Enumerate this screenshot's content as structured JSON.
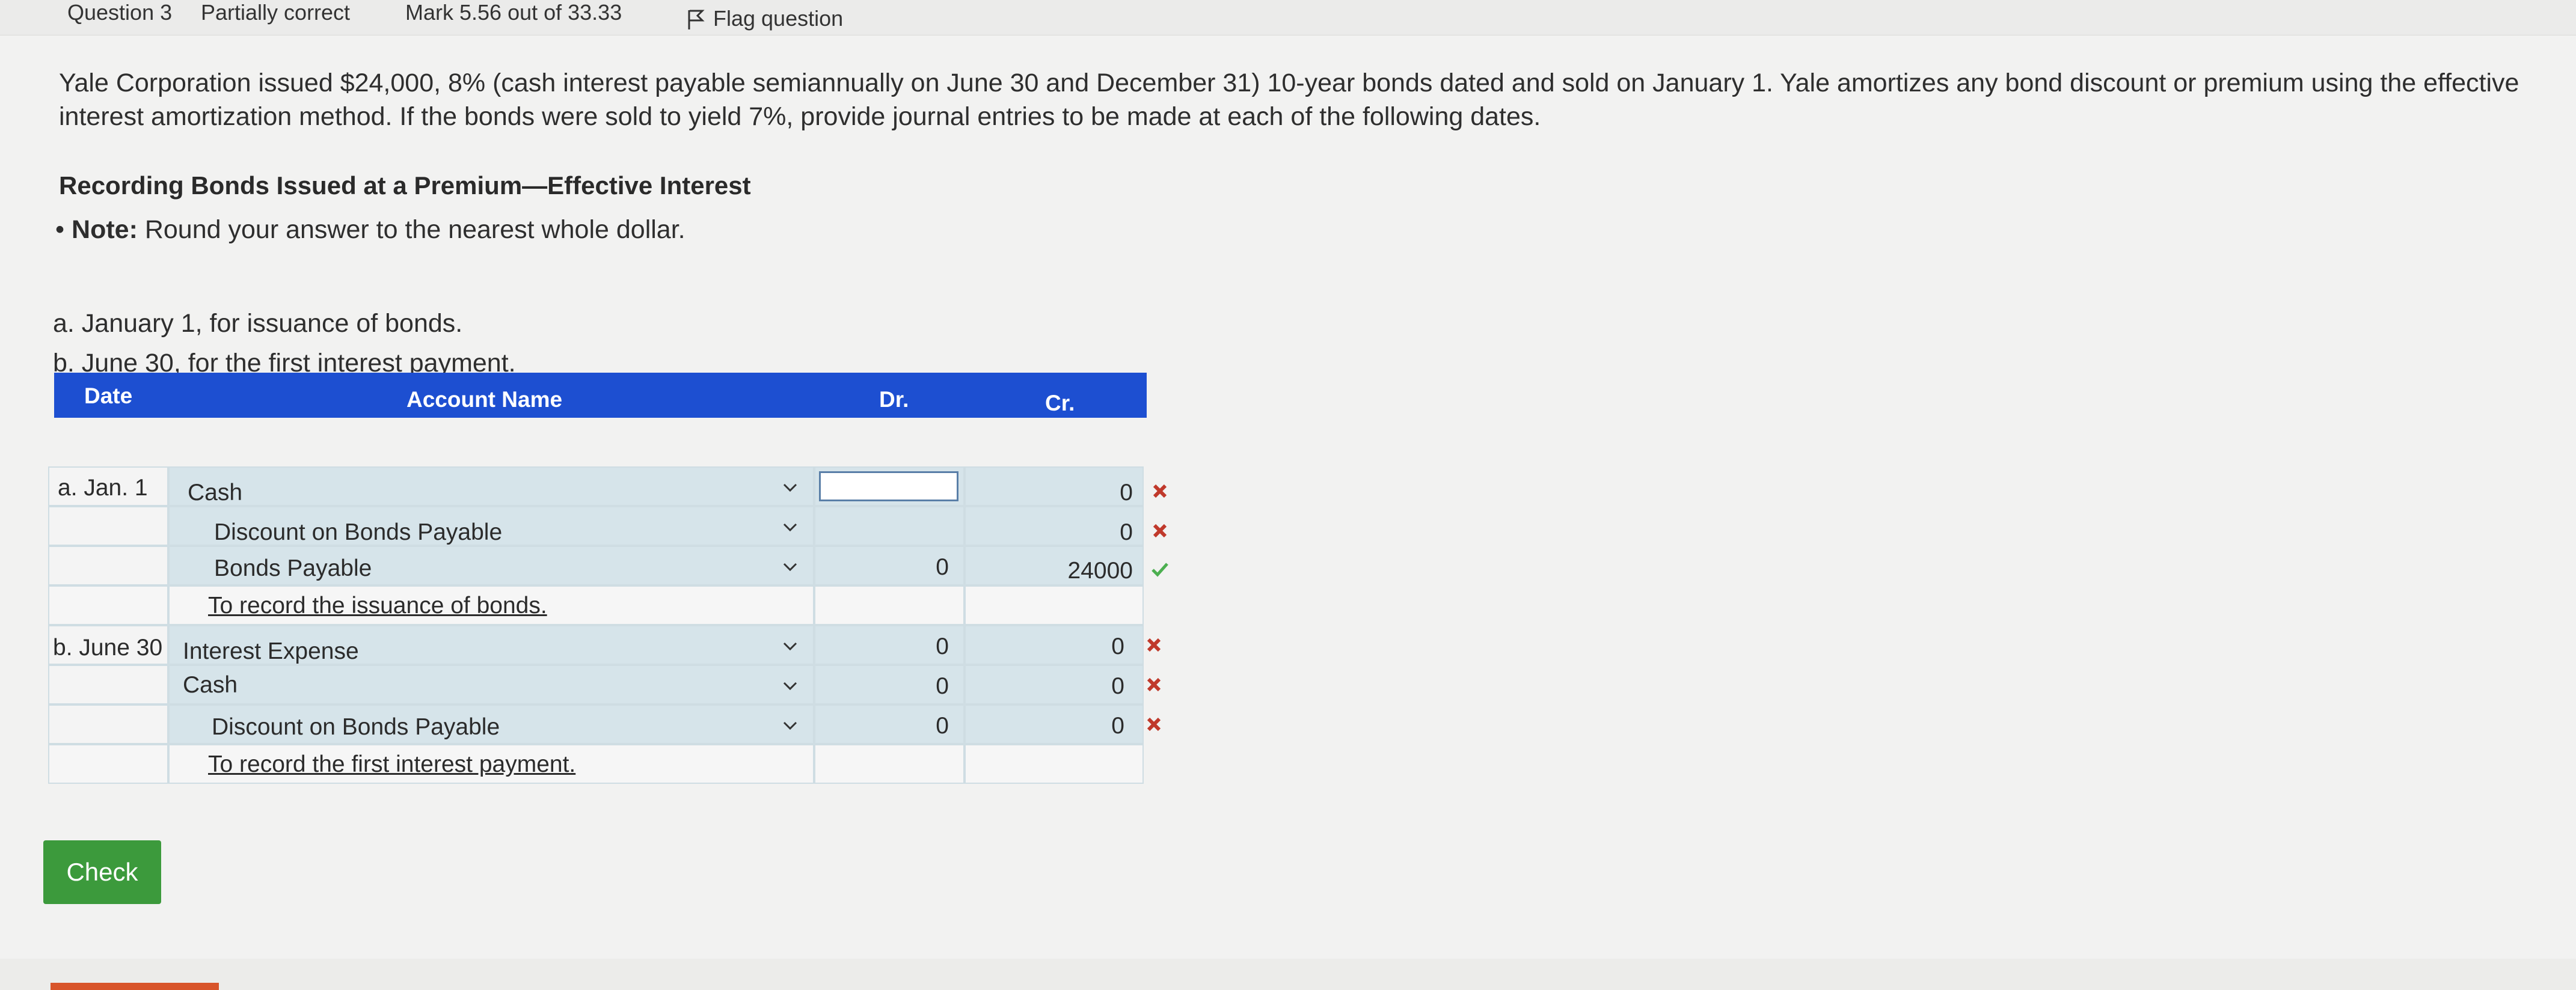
{
  "header": {
    "question": "Question 3",
    "status": "Partially correct",
    "mark": "Mark 5.56 out of 33.33",
    "flag": "Flag question"
  },
  "question": {
    "text": "Yale Corporation issued $24,000, 8% (cash interest payable semiannually on June 30 and December 31) 10-year bonds dated and sold on January 1. Yale amortizes any bond discount or premium using the effective interest amortization method. If the bonds were sold to yield 7%, provide journal entries to be made at each of the following dates.",
    "heading": "Recording Bonds Issued at a Premium—Effective Interest",
    "note_label": "Note:",
    "note_text": "Round your answer to the nearest whole dollar.",
    "items": [
      "a. January 1, for issuance of bonds.",
      "b. June 30, for the first interest payment."
    ]
  },
  "table": {
    "headers": {
      "date": "Date",
      "account": "Account Name",
      "dr": "Dr.",
      "cr": "Cr."
    },
    "rows": [
      {
        "date": "a. Jan. 1",
        "account": "Cash",
        "dr": "",
        "cr": "0",
        "mark": "x-icon"
      },
      {
        "date": "",
        "account": "Discount on Bonds Payable",
        "dr": "",
        "cr": "0",
        "mark": "x-icon"
      },
      {
        "date": "",
        "account": "Bonds Payable",
        "dr": "0",
        "cr": "24000",
        "mark": "check-icon"
      },
      {
        "date": "",
        "account": "To record the issuance of bonds.",
        "dr": "",
        "cr": "",
        "mark": ""
      },
      {
        "date": "b. June 30",
        "account": "Interest Expense",
        "dr": "0",
        "cr": "0",
        "mark": "x-icon"
      },
      {
        "date": "",
        "account": "Cash",
        "dr": "0",
        "cr": "0",
        "mark": "x-icon"
      },
      {
        "date": "",
        "account": "Discount on Bonds Payable",
        "dr": "0",
        "cr": "0",
        "mark": "x-icon"
      },
      {
        "date": "",
        "account": "To record the first interest payment.",
        "dr": "",
        "cr": "",
        "mark": ""
      }
    ]
  },
  "check_button": "Check",
  "colors": {
    "header_blue": "#1d4fd1",
    "incorrect": "#c0392b",
    "correct": "#4caf50",
    "check_green": "#3c9a3c"
  }
}
